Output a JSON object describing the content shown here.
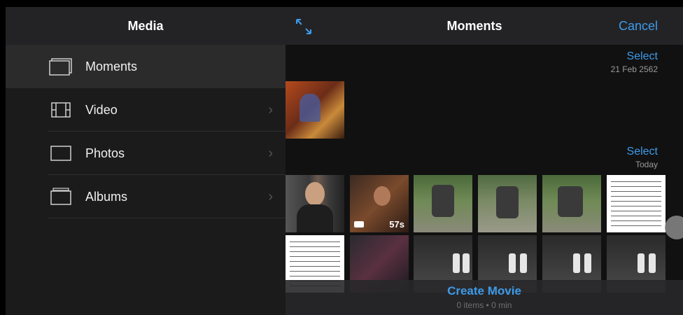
{
  "header": {
    "left_title": "Media",
    "right_title": "Moments",
    "cancel_label": "Cancel"
  },
  "sidebar": {
    "items": [
      {
        "label": "Moments",
        "icon": "moments-icon",
        "selected": true
      },
      {
        "label": "Video",
        "icon": "film-icon",
        "chevron": "›"
      },
      {
        "label": "Photos",
        "icon": "photo-icon",
        "chevron": "›"
      },
      {
        "label": "Albums",
        "icon": "album-icon",
        "chevron": "›"
      }
    ]
  },
  "moments": [
    {
      "select_label": "Select",
      "date": "21 Feb 2562"
    },
    {
      "select_label": "Select",
      "date": "Today",
      "video_duration": "57s"
    }
  ],
  "footer": {
    "create_label": "Create Movie",
    "summary": "0 items • 0 min"
  },
  "colors": {
    "accent": "#3d9bea",
    "background": "#1c1c1e"
  }
}
